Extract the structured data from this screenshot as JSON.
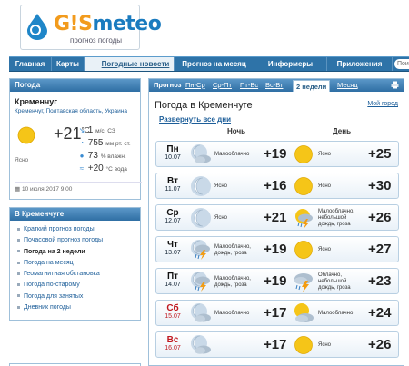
{
  "logo": {
    "text_main": "G!S",
    "text_rest": "meteo",
    "subtitle": "прогноз погоды"
  },
  "nav": {
    "items": [
      "Главная",
      "Карты",
      "Погодные новости",
      "Прогноз на месяц",
      "Информеры",
      "Приложения"
    ],
    "search_placeholder": "Пои"
  },
  "weather_panel": {
    "title": "Погода",
    "city": "Кременчуг",
    "breadcrumbs": "Кременчуг, Полтавская область, Украина",
    "temp": "+21",
    "temp_unit": "°C",
    "condition": "Ясно",
    "wind": "1",
    "wind_unit": "м/с, СЗ",
    "pressure": "755",
    "pressure_unit": "мм рт. ст.",
    "humidity": "73",
    "humidity_unit": "% влажн.",
    "water": "+20",
    "water_unit": "°С вода",
    "updated": "10 июля 2017 9:00"
  },
  "side_panel": {
    "title": "В Кременчуге",
    "items": [
      "Краткий прогноз погоды",
      "Почасовой прогноз погоды",
      "Погода на 2 недели",
      "Погода на месяц",
      "Геомагнитная обстановка",
      "Погода по-старому",
      "Погода для занятых",
      "Дневник погоды"
    ]
  },
  "main": {
    "tabs": [
      "Прогноз",
      "Пн-Ср",
      "Ср-Пт",
      "Пт-Вс",
      "Вс-Вт",
      "2 недели",
      "Месяц"
    ],
    "title": "Погода в Кременчуге",
    "my_city": "Мой город",
    "expand": "Развернуть все дни",
    "night_label": "Ночь",
    "day_label": "День"
  },
  "forecast": [
    {
      "dow": "Пн",
      "date": "10.07",
      "weekend": false,
      "night_icon": "moon-cloud-icon",
      "night_cond": "Малооблачно",
      "night_temp": "+19",
      "day_icon": "sun-icon",
      "day_cond": "Ясно",
      "day_temp": "+25"
    },
    {
      "dow": "Вт",
      "date": "11.07",
      "weekend": false,
      "night_icon": "moon-icon",
      "night_cond": "Ясно",
      "night_temp": "+16",
      "day_icon": "sun-icon",
      "day_cond": "Ясно",
      "day_temp": "+30"
    },
    {
      "dow": "Ср",
      "date": "12.07",
      "weekend": false,
      "night_icon": "moon-icon",
      "night_cond": "Ясно",
      "night_temp": "+21",
      "day_icon": "sun-storm-icon",
      "day_cond": "Малооблачно, небольшой дождь, гроза",
      "day_temp": "+26"
    },
    {
      "dow": "Чт",
      "date": "13.07",
      "weekend": false,
      "night_icon": "moon-storm-icon",
      "night_cond": "Малооблачно, дождь, гроза",
      "night_temp": "+19",
      "day_icon": "sun-icon",
      "day_cond": "Ясно",
      "day_temp": "+27"
    },
    {
      "dow": "Пт",
      "date": "14.07",
      "weekend": false,
      "night_icon": "moon-storm-icon",
      "night_cond": "Малооблачно, дождь, гроза",
      "night_temp": "+19",
      "day_icon": "cloud-storm-icon",
      "day_cond": "Облачно, небольшой дождь, гроза",
      "day_temp": "+23"
    },
    {
      "dow": "Сб",
      "date": "15.07",
      "weekend": true,
      "night_icon": "moon-cloud-icon",
      "night_cond": "Малооблачно",
      "night_temp": "+17",
      "day_icon": "sun-cloud-icon",
      "day_cond": "Малооблачно",
      "day_temp": "+24"
    },
    {
      "dow": "Вс",
      "date": "16.07",
      "weekend": true,
      "night_icon": "moon-cloud-icon",
      "night_cond": "",
      "night_temp": "+17",
      "day_icon": "sun-icon",
      "day_cond": "Ясно",
      "day_temp": "+26"
    }
  ],
  "colors": {
    "nav": "#2e73a8",
    "link": "#1d5e99",
    "weekend": "#c0181f",
    "sun": "#f5c518"
  }
}
